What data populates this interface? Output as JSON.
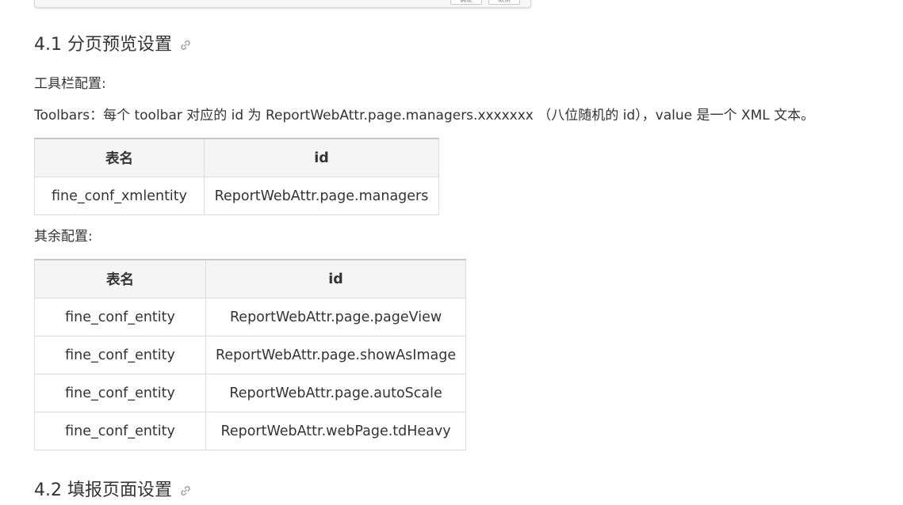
{
  "top_screenshot": {
    "buttons": [
      "确定",
      "取消"
    ]
  },
  "section_4_1": {
    "title": "4.1 分页预览设置",
    "link_icon": "link-icon",
    "toolbar_label": "工具栏配置:",
    "toolbars_text": "Toolbars：每个 toolbar 对应的 id 为 ReportWebAttr.page.managers.xxxxxxx （八位随机的 id），value 是一个 XML 文本。",
    "table1": {
      "headers": [
        "表名",
        "id"
      ],
      "rows": [
        [
          "fine_conf_xmlentity",
          "ReportWebAttr.page.managers"
        ]
      ]
    },
    "other_label": "其余配置:",
    "table2": {
      "headers": [
        "表名",
        "id"
      ],
      "rows": [
        [
          "fine_conf_entity",
          "ReportWebAttr.page.pageView"
        ],
        [
          "fine_conf_entity",
          "ReportWebAttr.page.showAsImage"
        ],
        [
          "fine_conf_entity",
          "ReportWebAttr.page.autoScale"
        ],
        [
          "fine_conf_entity",
          "ReportWebAttr.webPage.tdHeavy"
        ]
      ]
    }
  },
  "section_4_2": {
    "title": "4.2 填报页面设置",
    "link_icon": "link-icon"
  },
  "colors": {
    "text": "#333333",
    "header_bg": "#f5f5f5",
    "border": "#dcdcdc",
    "link_icon": "#999999"
  }
}
